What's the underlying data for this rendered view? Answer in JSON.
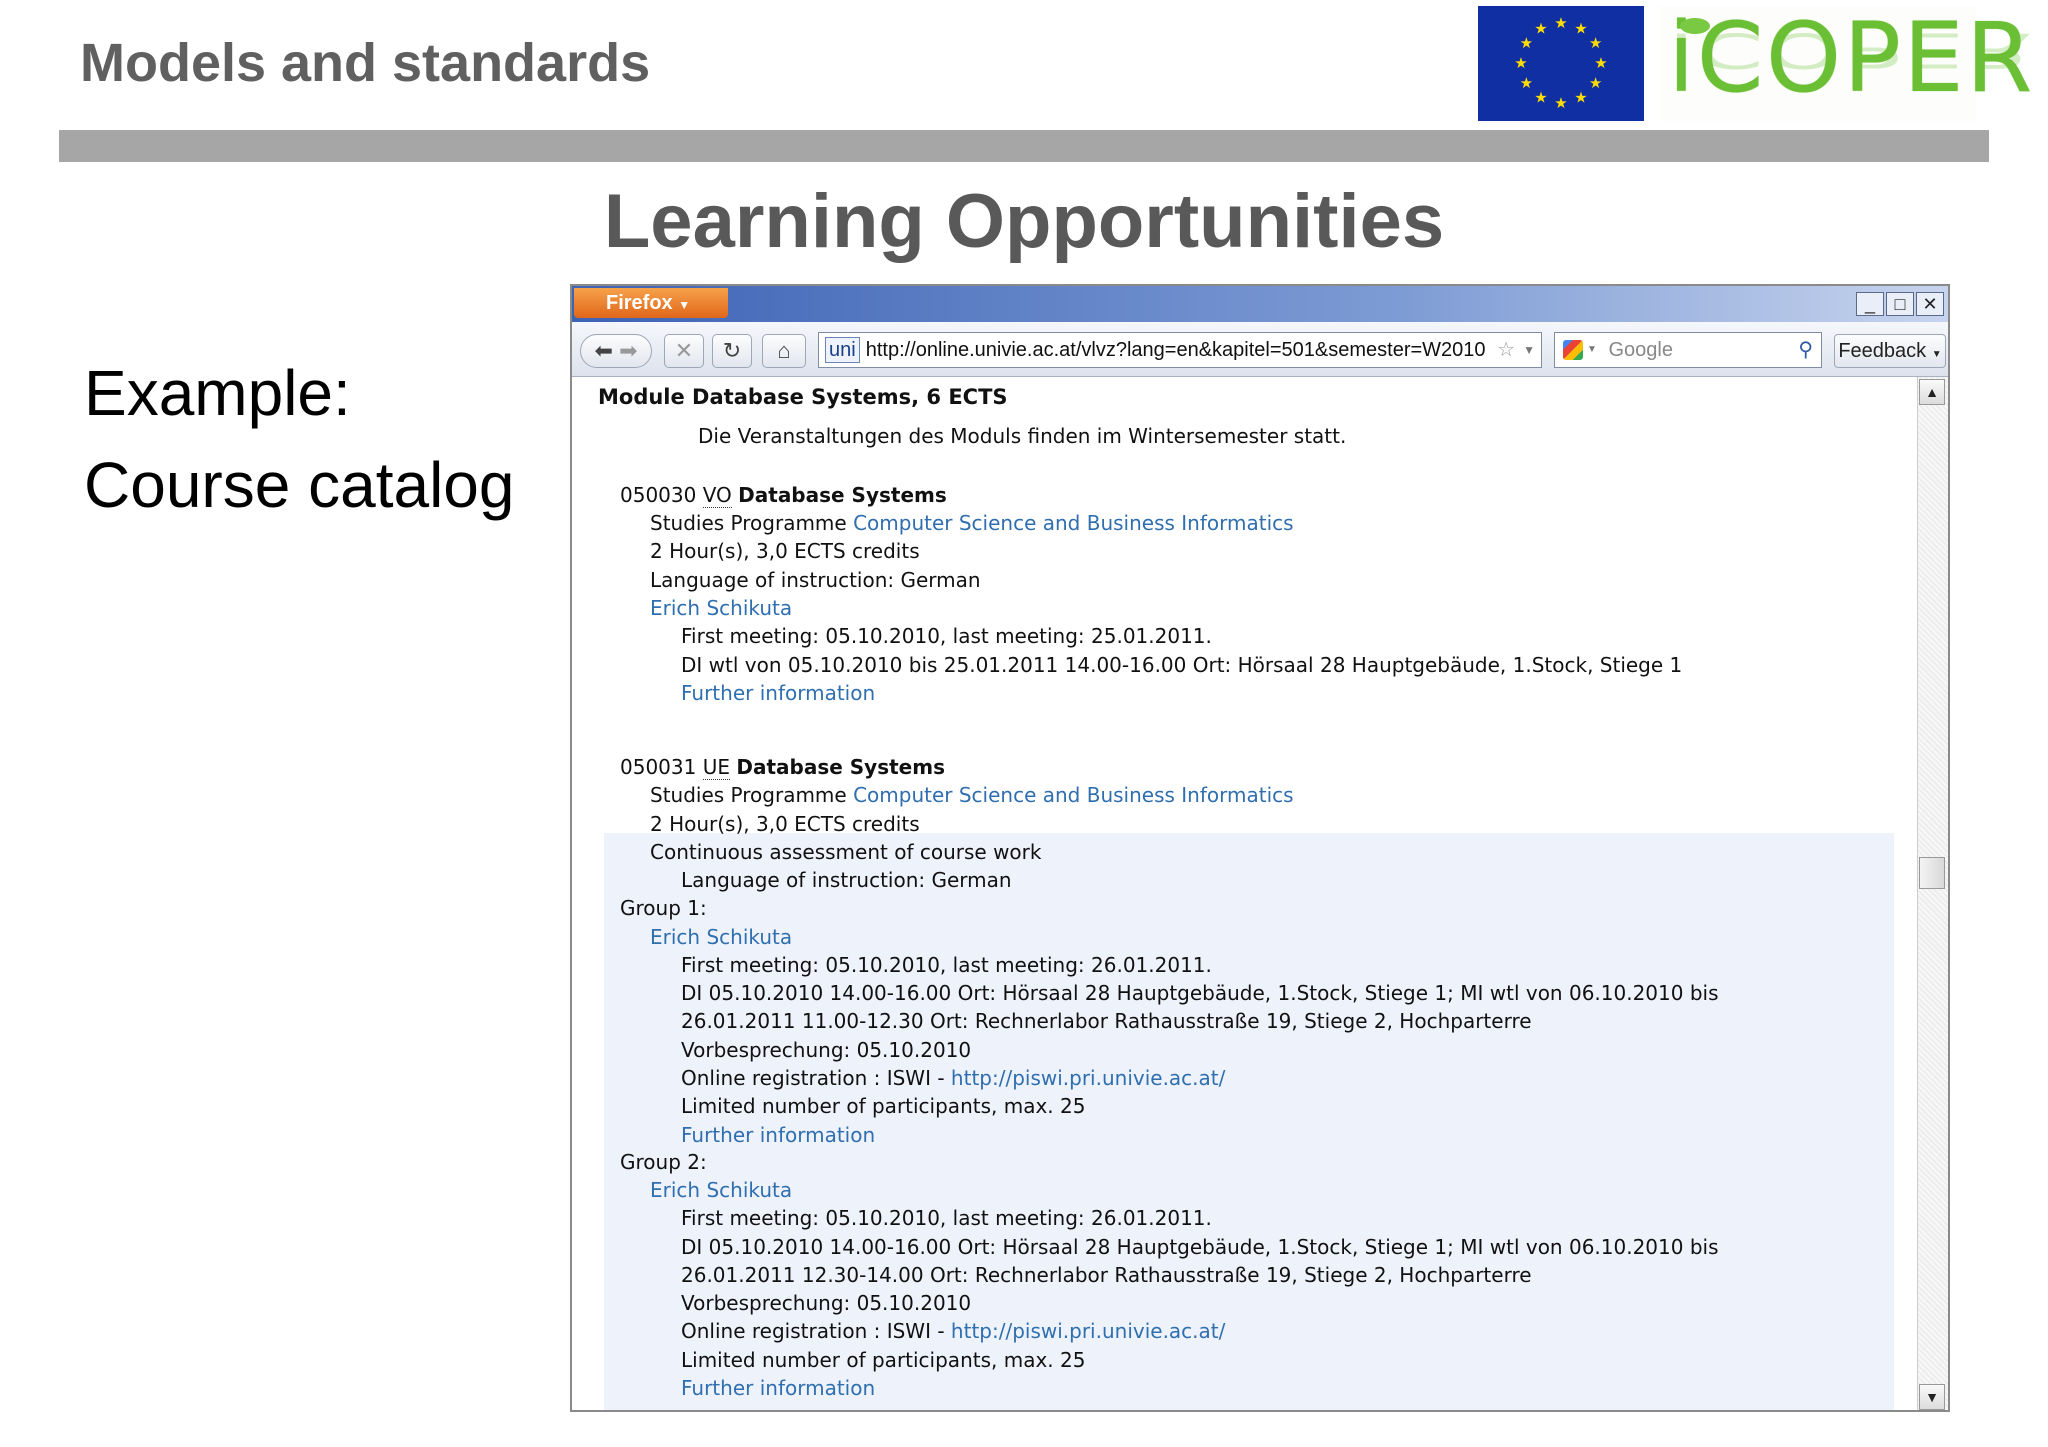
{
  "slide": {
    "title": "Models and standards",
    "heading": "Learning Opportunities",
    "side_line1": "Example:",
    "side_line2": "Course catalog",
    "logo_text": "iCOPER"
  },
  "colors": {
    "title_bar": "#a6a6a6",
    "eu_blue": "#0f2fa3",
    "eu_star": "#ffdd00",
    "logo_green": "#6bbf34",
    "link": "#2f6fb0"
  },
  "browser": {
    "app_menu": "Firefox",
    "url": "http://online.univie.ac.at/vlvz?lang=en&kapitel=501&semester=W2010",
    "url_badge": "uni",
    "search_placeholder": "Google",
    "feedback_label": "Feedback",
    "minimize": "_",
    "maximize": "□",
    "close": "✕"
  },
  "module": {
    "title": "Module Database Systems, 6 ECTS",
    "note": "Die Veranstaltungen des Moduls finden im Wintersemester statt.",
    "courses": [
      {
        "number": "050030",
        "type": "VO",
        "name": "Database Systems",
        "programme_label": "Studies Programme",
        "programme": "Computer Science and Business Informatics",
        "hours": "2 Hour(s), 3,0 ECTS credits",
        "language": "Language of instruction: German",
        "lecturer": "Erich Schikuta",
        "meetings": "First meeting: 05.10.2010, last meeting: 25.01.2011.",
        "schedule": "DI wtl von 05.10.2010 bis 25.01.2011 14.00-16.00 Ort: Hörsaal 28 Hauptgebäude, 1.Stock, Stiege 1",
        "further": "Further information"
      },
      {
        "number": "050031",
        "type": "UE",
        "name": "Database Systems",
        "programme_label": "Studies Programme",
        "programme": "Computer Science and Business Informatics",
        "hours": "2 Hour(s), 3,0 ECTS credits",
        "assessment": "Continuous assessment of course work",
        "language": "Language of instruction: German",
        "groups": [
          {
            "label": "Group 1:",
            "lecturer": "Erich Schikuta",
            "meetings": "First meeting: 05.10.2010, last meeting: 26.01.2011.",
            "schedule_1": "DI 05.10.2010 14.00-16.00 Ort: Hörsaal 28 Hauptgebäude, 1.Stock, Stiege 1; MI wtl von 06.10.2010 bis",
            "schedule_2": "26.01.2011 11.00-12.30 Ort: Rechnerlabor Rathausstraße 19, Stiege 2, Hochparterre",
            "prebriefing": "Vorbesprechung: 05.10.2010",
            "registration_label": "Online registration : ISWI - ",
            "registration_link": "http://piswi.pri.univie.ac.at/",
            "limit": "Limited number of participants, max. 25",
            "further": "Further information"
          },
          {
            "label": "Group 2:",
            "lecturer": "Erich Schikuta",
            "meetings": "First meeting: 05.10.2010, last meeting: 26.01.2011.",
            "schedule_1": "DI 05.10.2010 14.00-16.00 Ort: Hörsaal 28 Hauptgebäude, 1.Stock, Stiege 1; MI wtl von 06.10.2010 bis",
            "schedule_2": "26.01.2011 12.30-14.00 Ort: Rechnerlabor Rathausstraße 19, Stiege 2, Hochparterre",
            "prebriefing": "Vorbesprechung: 05.10.2010",
            "registration_label": "Online registration : ISWI - ",
            "registration_link": "http://piswi.pri.univie.ac.at/",
            "limit": "Limited number of participants, max. 25",
            "further": "Further information"
          }
        ]
      }
    ]
  }
}
